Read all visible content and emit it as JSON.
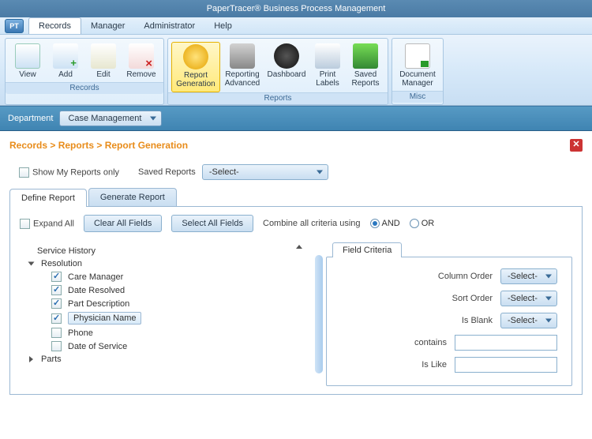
{
  "title": "PaperTracer® Business Process Management",
  "logo_text": "PT",
  "menu": [
    "Records",
    "Manager",
    "Administrator",
    "Help"
  ],
  "menu_active": 0,
  "ribbon": {
    "groups": [
      {
        "title": "Records",
        "buttons": [
          {
            "label": "View",
            "icon": "docs"
          },
          {
            "label": "Add",
            "icon": "add"
          },
          {
            "label": "Edit",
            "icon": "edit"
          },
          {
            "label": "Remove",
            "icon": "remove"
          }
        ]
      },
      {
        "title": "Reports",
        "buttons": [
          {
            "label": "Report Generation",
            "icon": "report",
            "active": true
          },
          {
            "label": "Reporting Advanced",
            "icon": "radv"
          },
          {
            "label": "Dashboard",
            "icon": "dash"
          },
          {
            "label": "Print Labels",
            "icon": "print"
          },
          {
            "label": "Saved Reports",
            "icon": "saved"
          }
        ]
      },
      {
        "title": "Misc",
        "buttons": [
          {
            "label": "Document Manager",
            "icon": "docm"
          }
        ]
      }
    ]
  },
  "dept": {
    "label": "Department",
    "value": "Case Management"
  },
  "breadcrumb": "Records > Reports > Report Generation",
  "show_my_reports": "Show My Reports only",
  "saved_reports": {
    "label": "Saved Reports",
    "value": "-Select-"
  },
  "tabs": [
    "Define Report",
    "Generate Report"
  ],
  "tab_active": 0,
  "expand_all": "Expand All",
  "clear_all": "Clear All Fields",
  "select_all": "Select All Fields",
  "combine_label": "Combine all criteria using",
  "radios": {
    "and": "AND",
    "or": "OR",
    "selected": "and"
  },
  "tree": {
    "root0": "Service History",
    "root1": "Resolution",
    "items": [
      {
        "label": "Care Manager",
        "checked": true
      },
      {
        "label": "Date Resolved",
        "checked": true
      },
      {
        "label": "Part Description",
        "checked": true
      },
      {
        "label": "Physician Name",
        "checked": true,
        "selected": true
      },
      {
        "label": "Phone",
        "checked": false
      },
      {
        "label": "Date of Service",
        "checked": false
      }
    ],
    "root2": "Parts"
  },
  "fc": {
    "title": "Field Criteria",
    "rows": [
      {
        "label": "Column Order",
        "type": "select",
        "value": "-Select-"
      },
      {
        "label": "Sort Order",
        "type": "select",
        "value": "-Select-"
      },
      {
        "label": "Is Blank",
        "type": "select",
        "value": "-Select-"
      },
      {
        "label": "contains",
        "type": "text",
        "value": ""
      },
      {
        "label": "Is Like",
        "type": "text",
        "value": ""
      }
    ]
  }
}
